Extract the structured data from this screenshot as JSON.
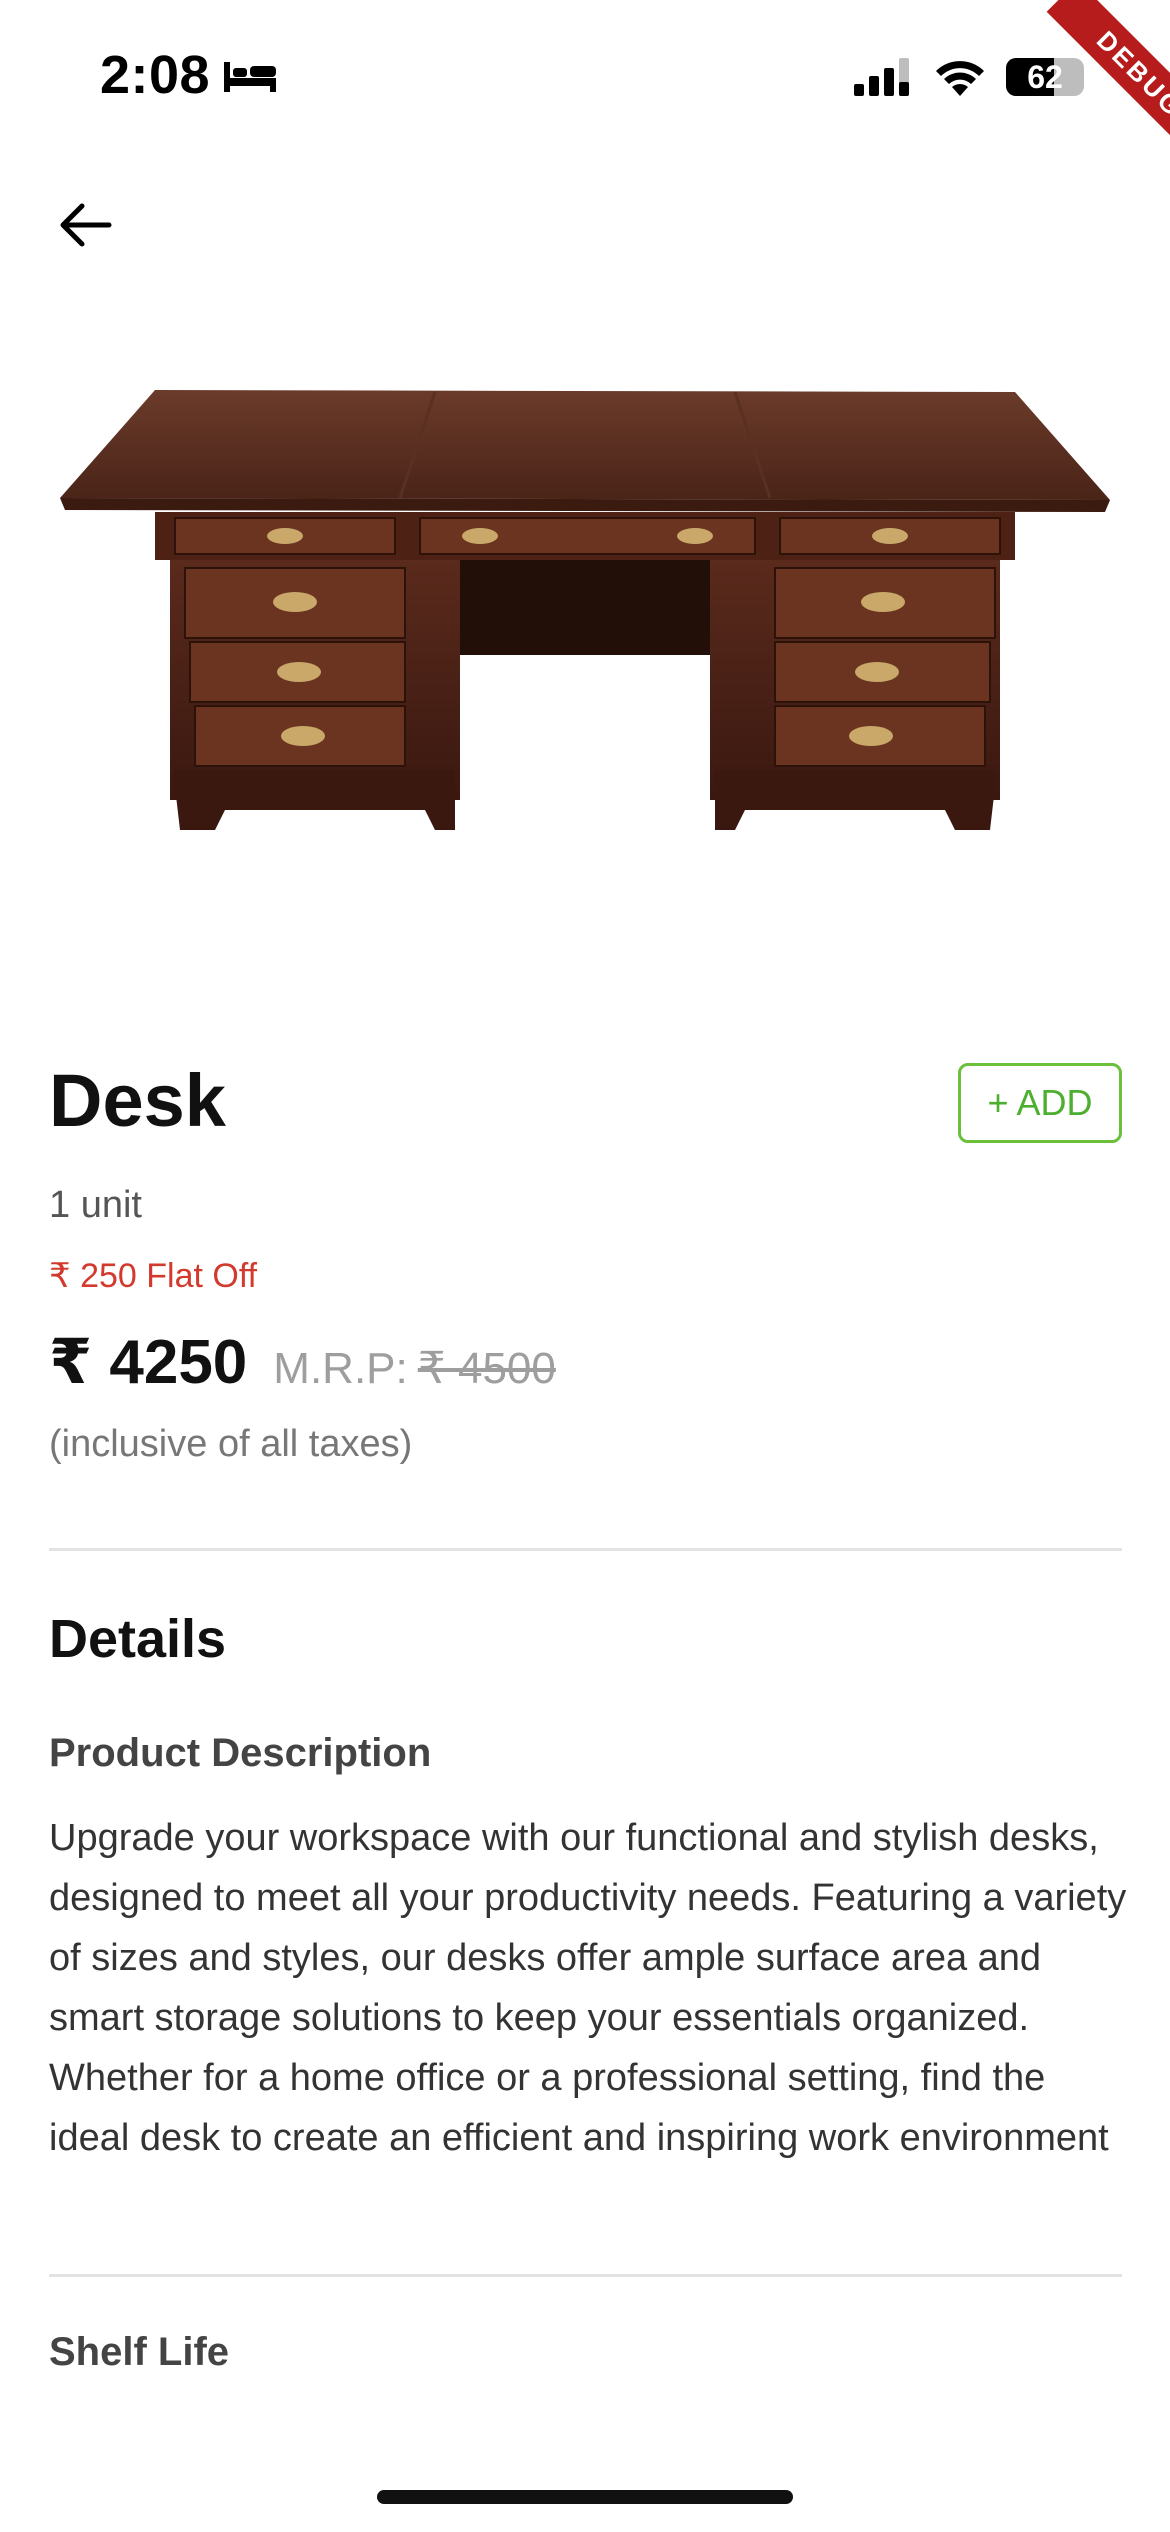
{
  "status_bar": {
    "time": "2:08",
    "battery_level": 62,
    "battery_label": "62",
    "debug_label": "DEBUG",
    "icons": [
      "bed-icon",
      "signal-icon",
      "wifi-icon",
      "battery-icon"
    ]
  },
  "nav": {
    "back_icon": "arrow-left-icon"
  },
  "product": {
    "image_icon": "desk-image",
    "name": "Desk",
    "add_label": "+ ADD",
    "unit": "1 unit",
    "discount": "₹ 250 Flat Off",
    "price": "₹ 4250",
    "mrp_label": "M.R.P:",
    "mrp_value": "₹ 4500",
    "tax_note": "(inclusive of all taxes)"
  },
  "details": {
    "heading": "Details",
    "description_label": "Product Description",
    "description": "Upgrade your workspace with our functional and stylish desks, designed to meet all your productivity needs. Featuring a variety of sizes and styles, our desks offer ample surface area and smart storage solutions to keep your essentials organized. Whether for a home office or a professional setting, find the ideal desk to create an efficient and inspiring work environment",
    "shelf_life_label": "Shelf Life"
  },
  "colors": {
    "accent_green": "#4caf30",
    "discount_red": "#d23a2e",
    "debug_red": "#b71c1c"
  }
}
